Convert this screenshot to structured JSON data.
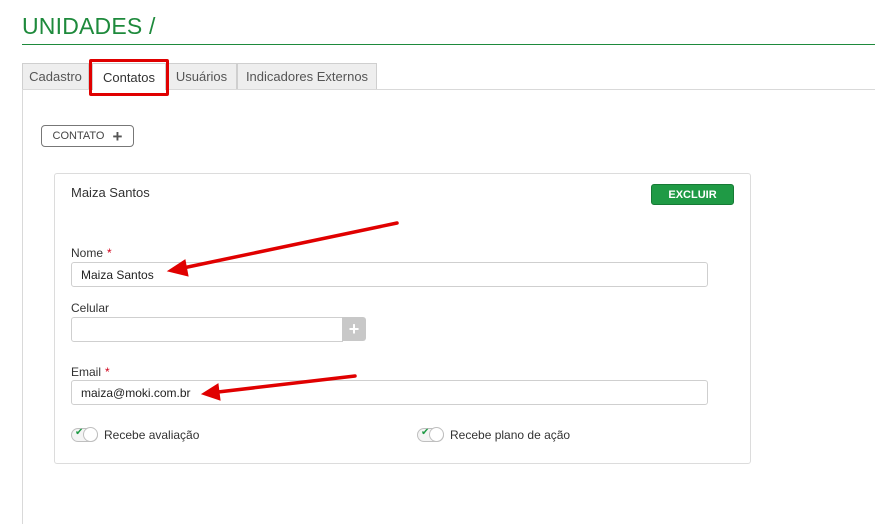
{
  "page": {
    "title": "UNIDADES /"
  },
  "tabs": [
    {
      "label": "Cadastro",
      "active": false
    },
    {
      "label": "Contatos",
      "active": true
    },
    {
      "label": "Usuários",
      "active": false
    },
    {
      "label": "Indicadores Externos",
      "active": false
    }
  ],
  "add_contact": {
    "label": "CONTATO",
    "icon": "plus-icon"
  },
  "contact_card": {
    "name": "Maiza Santos",
    "delete_label": "EXCLUIR",
    "fields": {
      "nome": {
        "label": "Nome",
        "required_mark": "*",
        "value": "Maiza Santos"
      },
      "celular": {
        "label": "Celular",
        "value": ""
      },
      "email": {
        "label": "Email",
        "required_mark": "*",
        "value": "maiza@moki.com.br"
      }
    },
    "toggles": [
      {
        "label": "Recebe avaliação",
        "checked": true
      },
      {
        "label": "Recebe plano de ação",
        "checked": true
      }
    ]
  },
  "colors": {
    "brand_green": "#1e8a3c",
    "button_green": "#1f9a45",
    "annotation_red": "#e00000"
  }
}
